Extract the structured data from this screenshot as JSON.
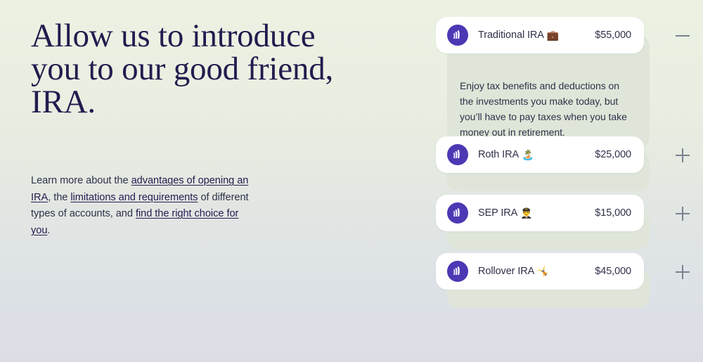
{
  "colors": {
    "bg_top": "#ecf2e2",
    "bg_bottom": "#dbdfe5",
    "heading": "#221c4f",
    "body_text": "#2f3148",
    "brand_circle": "#4b38b3",
    "card_surface": "#ffffff",
    "panel_surface": "#dfe6d9",
    "toggle_icon": "#7b8190"
  },
  "hero": {
    "headline": "Allow us to introduce you to our good friend, IRA.",
    "paragraph": {
      "part1": "Learn more about the ",
      "link1": "advantages of opening an IRA",
      "part2": ", the ",
      "link2": "limitations and requirements",
      "part3": " of different types of accounts, and ",
      "link3": "find the right choice for you",
      "part4": "."
    }
  },
  "accordion": {
    "items": [
      {
        "title": "Traditional IRA",
        "emoji": "💼",
        "emoji_name": "briefcase-emoji",
        "amount": "$55,000",
        "state": "expanded",
        "toggle_icon": "minus-icon",
        "description": "Enjoy tax benefits and deductions on the investments you make today, but you’ll have to pay taxes when you take money out in retirement."
      },
      {
        "title": "Roth IRA",
        "emoji": "🏝️",
        "emoji_name": "desert-island-emoji",
        "amount": "$25,000",
        "state": "collapsed",
        "toggle_icon": "plus-icon",
        "description": ""
      },
      {
        "title": "SEP IRA",
        "emoji": "👨‍✈️",
        "emoji_name": "pilot-emoji",
        "amount": "$15,000",
        "state": "collapsed",
        "toggle_icon": "plus-icon",
        "description": ""
      },
      {
        "title": "Rollover IRA",
        "emoji": "🤸",
        "emoji_name": "cartwheel-emoji",
        "amount": "$45,000",
        "state": "collapsed",
        "toggle_icon": "plus-icon",
        "description": ""
      }
    ]
  },
  "icons": {
    "brand": "brand-logo-icon"
  }
}
